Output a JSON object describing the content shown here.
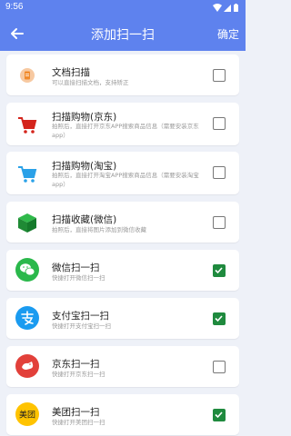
{
  "status": {
    "time": "9:56"
  },
  "header": {
    "title": "添加扫一扫",
    "confirm": "确定"
  },
  "items": [
    {
      "name": "文档扫描",
      "desc": "可以直接扫描文档，支持矫正",
      "checked": false
    },
    {
      "name": "扫描购物(京东)",
      "desc": "拍照后，直接打开京东APP搜索商品信息（需要安装京东app）",
      "checked": false
    },
    {
      "name": "扫描购物(淘宝)",
      "desc": "拍照后，直接打开淘宝APP搜索商品信息（需要安装淘宝app）",
      "checked": false
    },
    {
      "name": "扫描收藏(微信)",
      "desc": "拍照后，直接将图片添加到微信收藏",
      "checked": false
    },
    {
      "name": "微信扫一扫",
      "desc": "快捷打开微信扫一扫",
      "checked": true
    },
    {
      "name": "支付宝扫一扫",
      "desc": "快捷打开支付宝扫一扫",
      "checked": true
    },
    {
      "name": "京东扫一扫",
      "desc": "快捷打开京东扫一扫",
      "checked": false
    },
    {
      "name": "美团扫一扫",
      "desc": "快捷打开美团扫一扫",
      "checked": true
    }
  ],
  "icons": {
    "meituan_label": "美团"
  },
  "colors": {
    "primary": "#5e82ee",
    "check": "#1f8a3e"
  }
}
